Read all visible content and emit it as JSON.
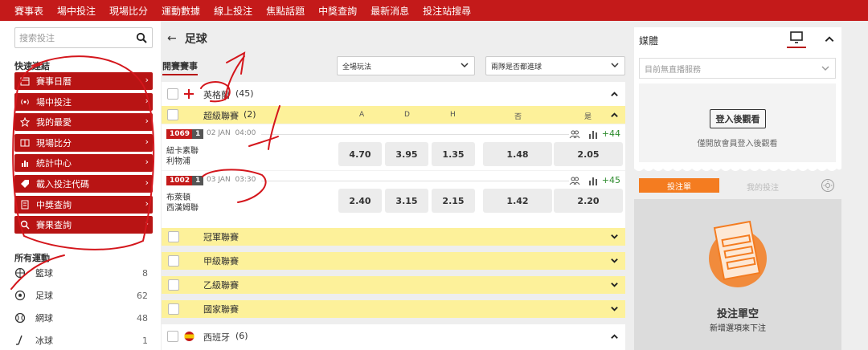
{
  "topnav": {
    "items": [
      "賽事表",
      "場中投注",
      "現場比分",
      "運動數據",
      "線上投注",
      "焦點話題",
      "中獎查詢",
      "最新消息",
      "投注站搜尋"
    ]
  },
  "left": {
    "search_placeholder": "搜索投注",
    "quick_title": "快速連結",
    "quick_links": [
      {
        "label": "賽事日曆",
        "icon": "calendar-icon"
      },
      {
        "label": "場中投注",
        "icon": "live-icon"
      },
      {
        "label": "我的最愛",
        "icon": "star-icon"
      },
      {
        "label": "現場比分",
        "icon": "scoreboard-icon"
      },
      {
        "label": "統計中心",
        "icon": "stats-icon"
      },
      {
        "label": "載入投注代碼",
        "icon": "tag-icon"
      },
      {
        "label": "中獎查詢",
        "icon": "ticket-icon"
      },
      {
        "label": "賽果查詢",
        "icon": "search-icon"
      }
    ],
    "sports_title": "所有運動",
    "sports": [
      {
        "label": "籃球",
        "count": "8",
        "icon": "basketball-icon"
      },
      {
        "label": "足球",
        "count": "62",
        "icon": "football-icon"
      },
      {
        "label": "網球",
        "count": "48",
        "icon": "tennis-icon"
      },
      {
        "label": "冰球",
        "count": "1",
        "icon": "hockey-icon"
      }
    ]
  },
  "main": {
    "title": "足球",
    "tab_label": "開賽賽事",
    "dropdown_market": "全場玩法",
    "dropdown_market2": "兩隊是否都進球",
    "leagues": [
      {
        "name": "英格蘭",
        "count": "(45)"
      },
      {
        "name": "西班牙",
        "count": "(6)"
      }
    ],
    "sub_league": {
      "name": "超級聯賽",
      "count": "(2)"
    },
    "col_headers": [
      "A",
      "D",
      "H",
      "否",
      "是"
    ],
    "matches": [
      {
        "id": "1069",
        "n": "1",
        "date": "02 JAN",
        "time": "04:00",
        "home": "紐卡素聯",
        "away": "利物浦",
        "odds": [
          "4.70",
          "3.95",
          "1.35",
          "1.48",
          "2.05"
        ],
        "more": "+44"
      },
      {
        "id": "1002",
        "n": "1",
        "date": "03 JAN",
        "time": "03:30",
        "home": "布萊頓",
        "away": "西漢姆聯",
        "odds": [
          "2.40",
          "3.15",
          "2.15",
          "1.42",
          "2.20"
        ],
        "more": "+45"
      }
    ],
    "collapsed": [
      "冠軍聯賽",
      "甲級聯賽",
      "乙級聯賽",
      "國家聯賽"
    ]
  },
  "right": {
    "media_title": "媒體",
    "media_dropdown": "目前無直播服務",
    "login_button": "登入後觀看",
    "login_note": "僅開放會員登入後觀看",
    "tab_betslip": "投注單",
    "tab_mybets": "我的投注",
    "empty_title": "投注單空",
    "empty_sub": "新增選項來下注"
  },
  "colors": {
    "brand": "#c41a1a",
    "accent_orange": "#f47c20",
    "league_yellow": "#fdf19a",
    "annotation": "#d4161c"
  }
}
